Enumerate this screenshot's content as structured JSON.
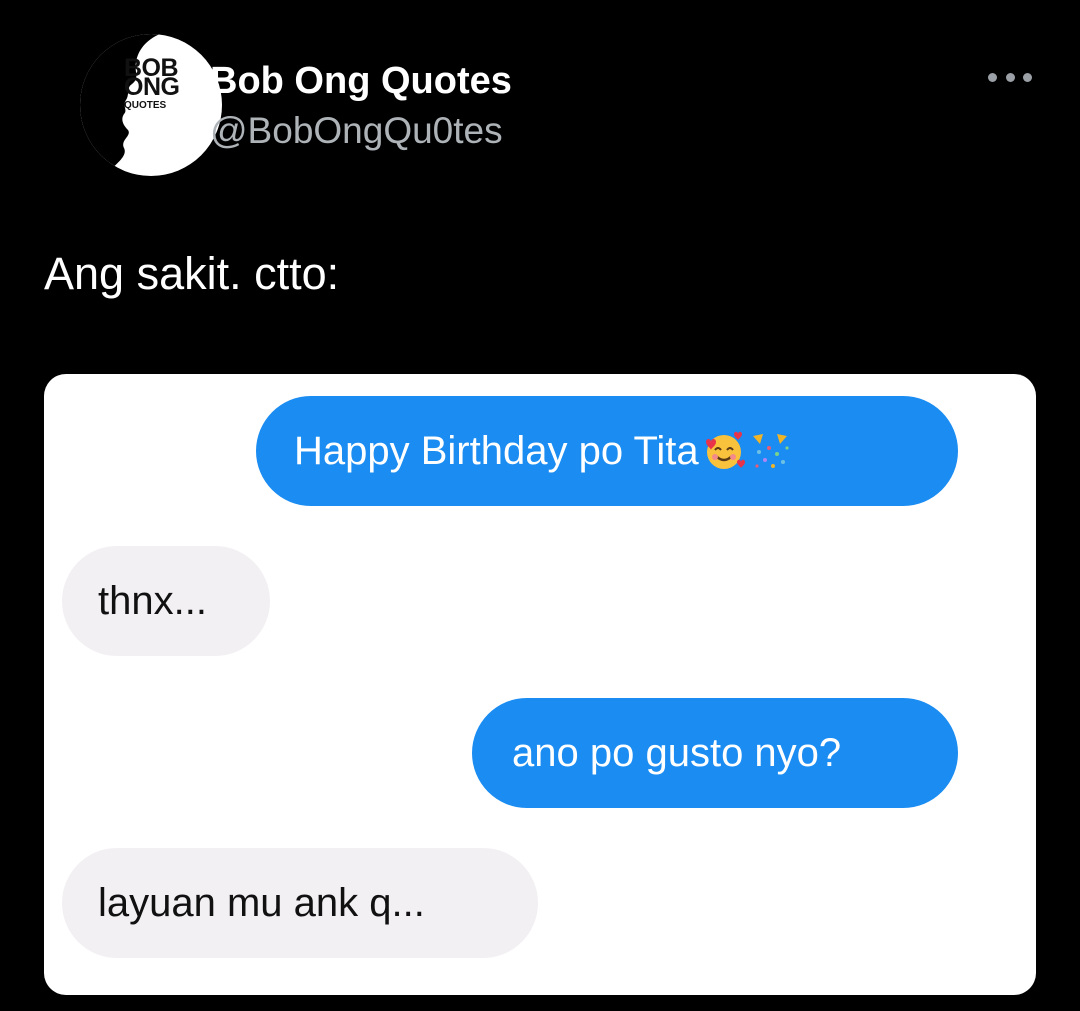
{
  "account": {
    "name": "Bob Ong Quotes",
    "handle": "@BobOngQu0tes",
    "avatar_logo": [
      "BOB",
      "ONG",
      "QUOTES"
    ]
  },
  "more_icon": "more-horizontal-icon",
  "tweet": {
    "text": "Ang sakit. ctto:"
  },
  "chat": {
    "messages": [
      {
        "side": "outgoing",
        "text": "Happy Birthday po Tita",
        "emojis": [
          "smiling-face-with-hearts-emoji",
          "party-popper-emoji"
        ]
      },
      {
        "side": "incoming",
        "text": "thnx..."
      },
      {
        "side": "outgoing",
        "text": "ano po gusto nyo?"
      },
      {
        "side": "incoming",
        "text": "layuan mu ank q..."
      }
    ]
  },
  "colors": {
    "background": "#000000",
    "outgoing_bubble": "#1a8cf2",
    "incoming_bubble": "#f3f0f3",
    "handle_text": "#aeb3b8"
  }
}
